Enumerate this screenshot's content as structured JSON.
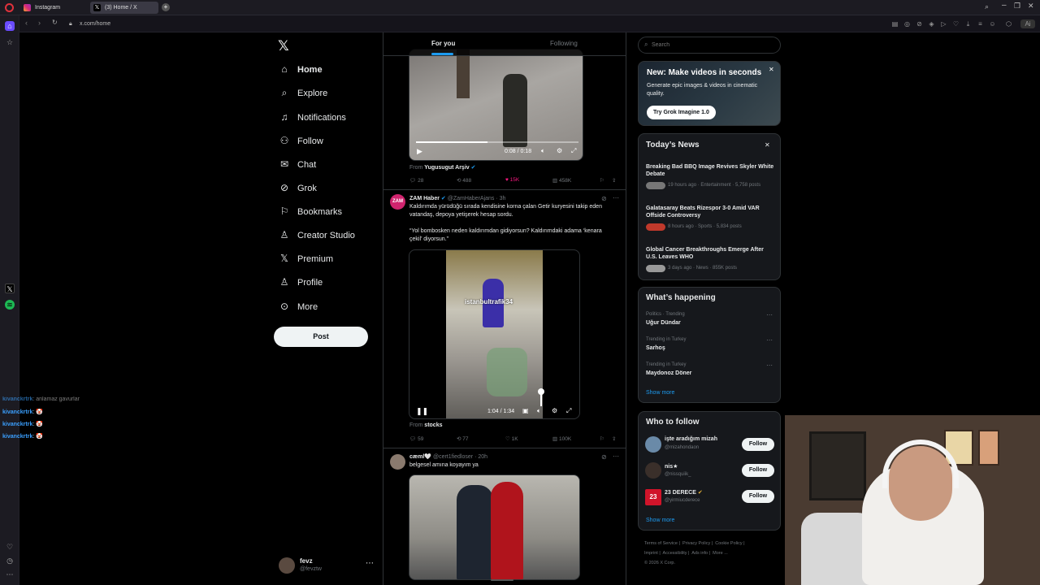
{
  "browser": {
    "tabs": [
      {
        "label": "Instagram",
        "active": false
      },
      {
        "label": "(3) Home / X",
        "active": true
      }
    ],
    "url": "x.com/home"
  },
  "nav": {
    "items": [
      {
        "label": "Home",
        "icon": "home-icon"
      },
      {
        "label": "Explore",
        "icon": "search-icon"
      },
      {
        "label": "Notifications",
        "icon": "bell-icon"
      },
      {
        "label": "Follow",
        "icon": "person-plus-icon"
      },
      {
        "label": "Chat",
        "icon": "mail-icon"
      },
      {
        "label": "Grok",
        "icon": "grok-icon"
      },
      {
        "label": "Bookmarks",
        "icon": "bookmark-icon"
      },
      {
        "label": "Creator Studio",
        "icon": "flask-icon"
      },
      {
        "label": "Premium",
        "icon": "x-icon"
      },
      {
        "label": "Profile",
        "icon": "person-icon"
      },
      {
        "label": "More",
        "icon": "more-circle-icon"
      }
    ],
    "post_label": "Post",
    "account": {
      "name": "fevz",
      "handle": "@fevztw"
    }
  },
  "feed": {
    "tabs": [
      "For you",
      "Following"
    ],
    "post1": {
      "video_time": "0:08 / 0:18",
      "from_label": "From",
      "from_name": "Yugusugut Arşiv",
      "stats": {
        "replies": "28",
        "reposts": "488",
        "likes": "15K",
        "views": "458K"
      }
    },
    "post2": {
      "name": "ZAM Haber",
      "handle": "@ZamHaberAjans",
      "time": "· 3h",
      "text1": "Kaldırımda yürüdüğü sırada kendisine korna çalan Getir kuryesini takip eden vatandaş, depoya yetişerek hesap sordu.",
      "text2": "“Yol bombosken neden kaldırımdan gidiyorsun? Kaldırımdaki adama ‘kenara çekil’ diyorsun.”",
      "watermark": "istanbultrafik34",
      "video_time": "1:04 / 1:34",
      "from_label": "From",
      "from_name": "stocks",
      "stats": {
        "replies": "59",
        "reposts": "77",
        "likes": "1K",
        "views": "100K"
      }
    },
    "post3": {
      "name": "cæml🤍",
      "handle": "@cert1fiedloser",
      "time": "· 20h",
      "text": "belgesel amına koyayım ya"
    }
  },
  "search": {
    "placeholder": "Search"
  },
  "grok_promo": {
    "title": "New: Make videos in seconds",
    "desc": "Generate epic images & videos in cinematic quality.",
    "button": "Try Grok Imagine 1.0"
  },
  "news": {
    "title": "Today’s News",
    "items": [
      {
        "title": "Breaking Bad BBQ Image Revives Skyler White Debate",
        "meta": "19 hours ago · Entertainment · 5,758 posts"
      },
      {
        "title": "Galatasaray Beats Rizespor 3-0 Amid VAR Offside Controversy",
        "meta": "8 hours ago · Sports · 5,834 posts"
      },
      {
        "title": "Global Cancer Breakthroughs Emerge After U.S. Leaves WHO",
        "meta": "3 days ago · News · 855K posts"
      }
    ]
  },
  "happening": {
    "title": "What’s happening",
    "items": [
      {
        "context": "Politics · Trending",
        "topic": "Uğur Dündar"
      },
      {
        "context": "Trending in Turkey",
        "topic": "Sarhoş"
      },
      {
        "context": "Trending in Turkey",
        "topic": "Maydonoz Döner"
      }
    ],
    "show_more": "Show more"
  },
  "who_to_follow": {
    "title": "Who to follow",
    "items": [
      {
        "name": "işte aradığım mizah",
        "handle": "@mizahondaon",
        "button": "Follow"
      },
      {
        "name": "nis★",
        "handle": "@nissquiik_",
        "button": "Follow"
      },
      {
        "name": "23 DERECE",
        "handle": "@yirmiucderece",
        "button": "Follow"
      }
    ],
    "show_more": "Show more"
  },
  "footer": {
    "links": [
      "Terms of Service",
      "|",
      "Privacy Policy",
      "|",
      "Cookie Policy",
      "|",
      "Imprint",
      "|",
      "Accessibility",
      "|",
      "Ads info",
      "|",
      "More ..."
    ],
    "copyright": "© 2026 X Corp."
  },
  "chat_overlay": [
    {
      "user": "kivanckrtrk",
      "msg": ": anlamaz gavurlar"
    },
    {
      "user": "kivanckrtrk",
      "msg": ": 🤡"
    },
    {
      "user": "kivanckrtrk",
      "msg": ": 🤡"
    },
    {
      "user": "kivanckrtrk",
      "msg": ": 🤡"
    }
  ]
}
